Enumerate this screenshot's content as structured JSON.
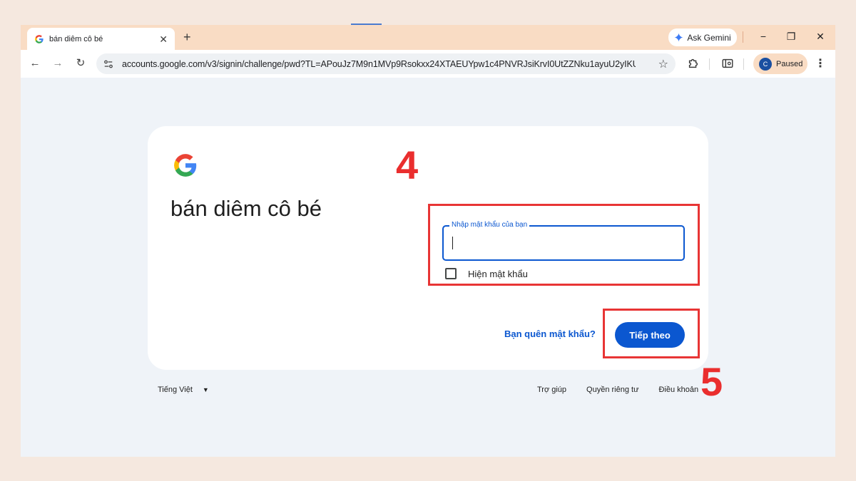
{
  "browser": {
    "tab_title": "bán diêm cô bé",
    "new_tab": "+",
    "tab_close": "✕",
    "gemini_label": "Ask Gemini",
    "url": "accounts.google.com/v3/signin/challenge/pwd?TL=APouJz7M9n1MVp9Rsokxx24XTAEUYpw1c4PNVRJsiKrvI0UtZZNku1ayuU2yIKU3...",
    "profile_initial": "C",
    "profile_status": "Paused",
    "minimize": "−",
    "restore": "❐",
    "close": "✕",
    "back": "←",
    "forward": "→",
    "reload": "↻",
    "bookmark": "☆",
    "menu": "⋮"
  },
  "signin": {
    "account_name": "bán diêm cô bé",
    "password_label": "Nhập mật khẩu của bạn",
    "password_value": "",
    "show_password_label": "Hiện mật khẩu",
    "show_password_checked": false,
    "forgot_password": "Bạn quên mật khẩu?",
    "next_button": "Tiếp theo"
  },
  "footer": {
    "language": "Tiếng Việt",
    "links": [
      "Trợ giúp",
      "Quyền riêng tư",
      "Điều khoản"
    ]
  },
  "annotations": {
    "step_password": "4",
    "step_next": "5",
    "highlight_color": "#e83535"
  },
  "colors": {
    "accent_blue": "#0b57d0",
    "tabstrip": "#f9dcc4",
    "page_background": "#eff3f8"
  }
}
